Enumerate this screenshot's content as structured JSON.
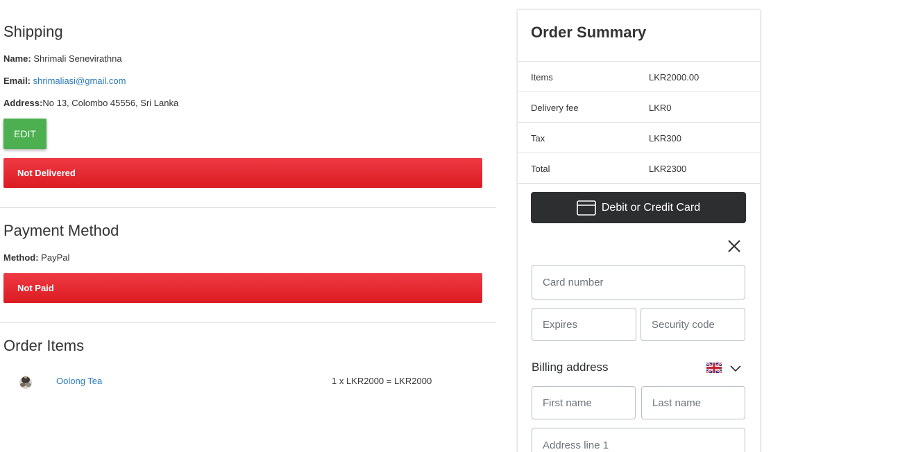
{
  "shipping": {
    "title": "Shipping",
    "name_label": "Name:",
    "name_value": "Shrimali Senevirathna",
    "email_label": "Email:",
    "email_value": "shrimaliasi@gmail.com",
    "address_label": "Address:",
    "address_value": "No 13, Colombo 45556, Sri Lanka",
    "edit_label": "EDIT",
    "status": "Not Delivered"
  },
  "payment": {
    "title": "Payment Method",
    "method_label": "Method:",
    "method_value": "PayPal",
    "status": "Not Paid"
  },
  "order_items": {
    "title": "Order Items",
    "items": [
      {
        "name": "Oolong Tea",
        "price_line": "1 x LKR2000 = LKR2000",
        "thumb_icon": "tea-product-image"
      }
    ]
  },
  "summary": {
    "title": "Order Summary",
    "rows": [
      {
        "label": "Items",
        "value": "LKR2000.00"
      },
      {
        "label": "Delivery fee",
        "value": "LKR0"
      },
      {
        "label": "Tax",
        "value": "LKR300"
      },
      {
        "label": "Total",
        "value": "LKR2300"
      }
    ]
  },
  "card_form": {
    "pay_button": "Debit or Credit Card",
    "card_icon": "credit-card-icon",
    "card_number_placeholder": "Card number",
    "expires_placeholder": "Expires",
    "security_placeholder": "Security code",
    "billing_title": "Billing address",
    "flag_icon": "uk-flag-icon",
    "first_name_placeholder": "First name",
    "last_name_placeholder": "Last name",
    "address1_placeholder": "Address line 1"
  },
  "colors": {
    "edit_green": "#4caf50",
    "alert_red": "#dc1b22",
    "link_blue": "#2a7ab8",
    "pay_dark": "#2c2e2f"
  }
}
